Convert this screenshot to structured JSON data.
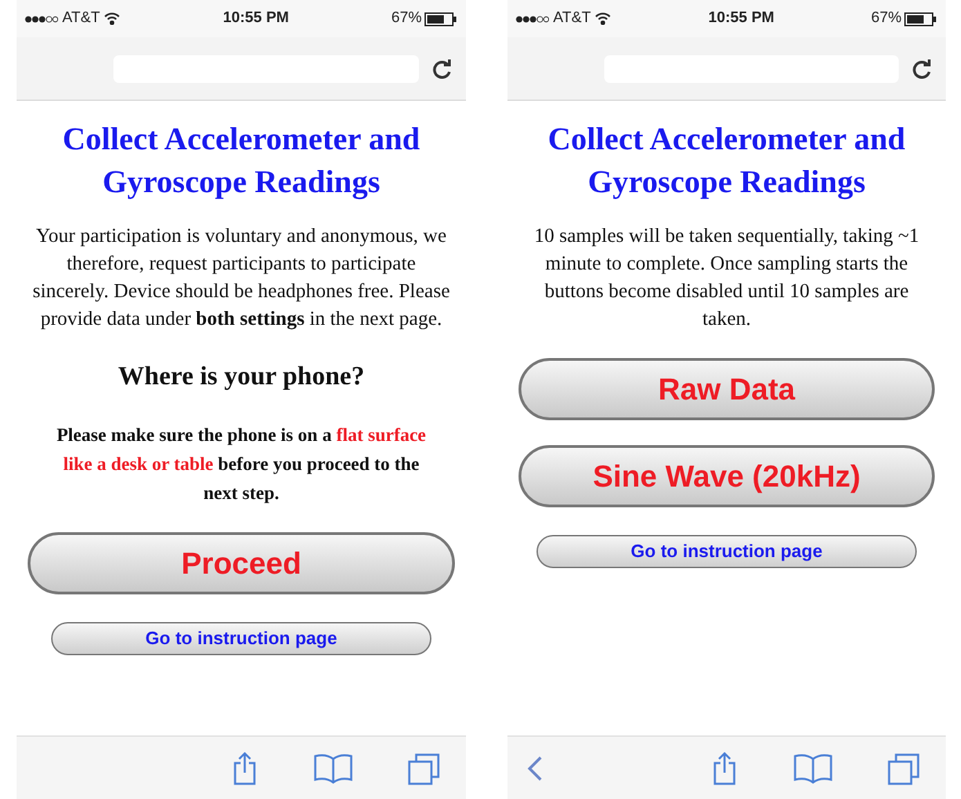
{
  "phones": [
    {
      "status": {
        "carrier": "AT&T",
        "time": "10:55 PM",
        "battery": "67%"
      },
      "title": "Collect Accelerometer and Gyroscope Readings",
      "back_button": false,
      "blocks": [
        {
          "kind": "paragraph",
          "text": "Your participation is voluntary and anonymous, we therefore, request participants to participate sincerely. Device should be headphones free. Please provide data under **both settings** in the next page."
        },
        {
          "kind": "heading",
          "text": "Where is your phone?"
        },
        {
          "kind": "notice",
          "parts": [
            {
              "text": "Please make sure the phone is on a ",
              "highlight": false
            },
            {
              "text": "flat surface like a desk or table",
              "highlight": true
            },
            {
              "text": " before you proceed to the next step.",
              "highlight": false
            }
          ]
        },
        {
          "kind": "big-button",
          "text": "Proceed"
        },
        {
          "kind": "small-button",
          "text": "Go to instruction page"
        }
      ]
    },
    {
      "status": {
        "carrier": "AT&T",
        "time": "10:55 PM",
        "battery": "67%"
      },
      "title": "Collect Accelerometer and Gyroscope Readings",
      "back_button": true,
      "blocks": [
        {
          "kind": "paragraph",
          "text": "10 samples will be taken sequentially, taking ~1 minute to complete. Once sampling starts the buttons become disabled until 10 samples are taken."
        },
        {
          "kind": "big-button",
          "text": "Raw Data"
        },
        {
          "kind": "big-button",
          "text": "Sine Wave (20kHz)"
        },
        {
          "kind": "small-button",
          "text": "Go to instruction page"
        }
      ]
    }
  ]
}
